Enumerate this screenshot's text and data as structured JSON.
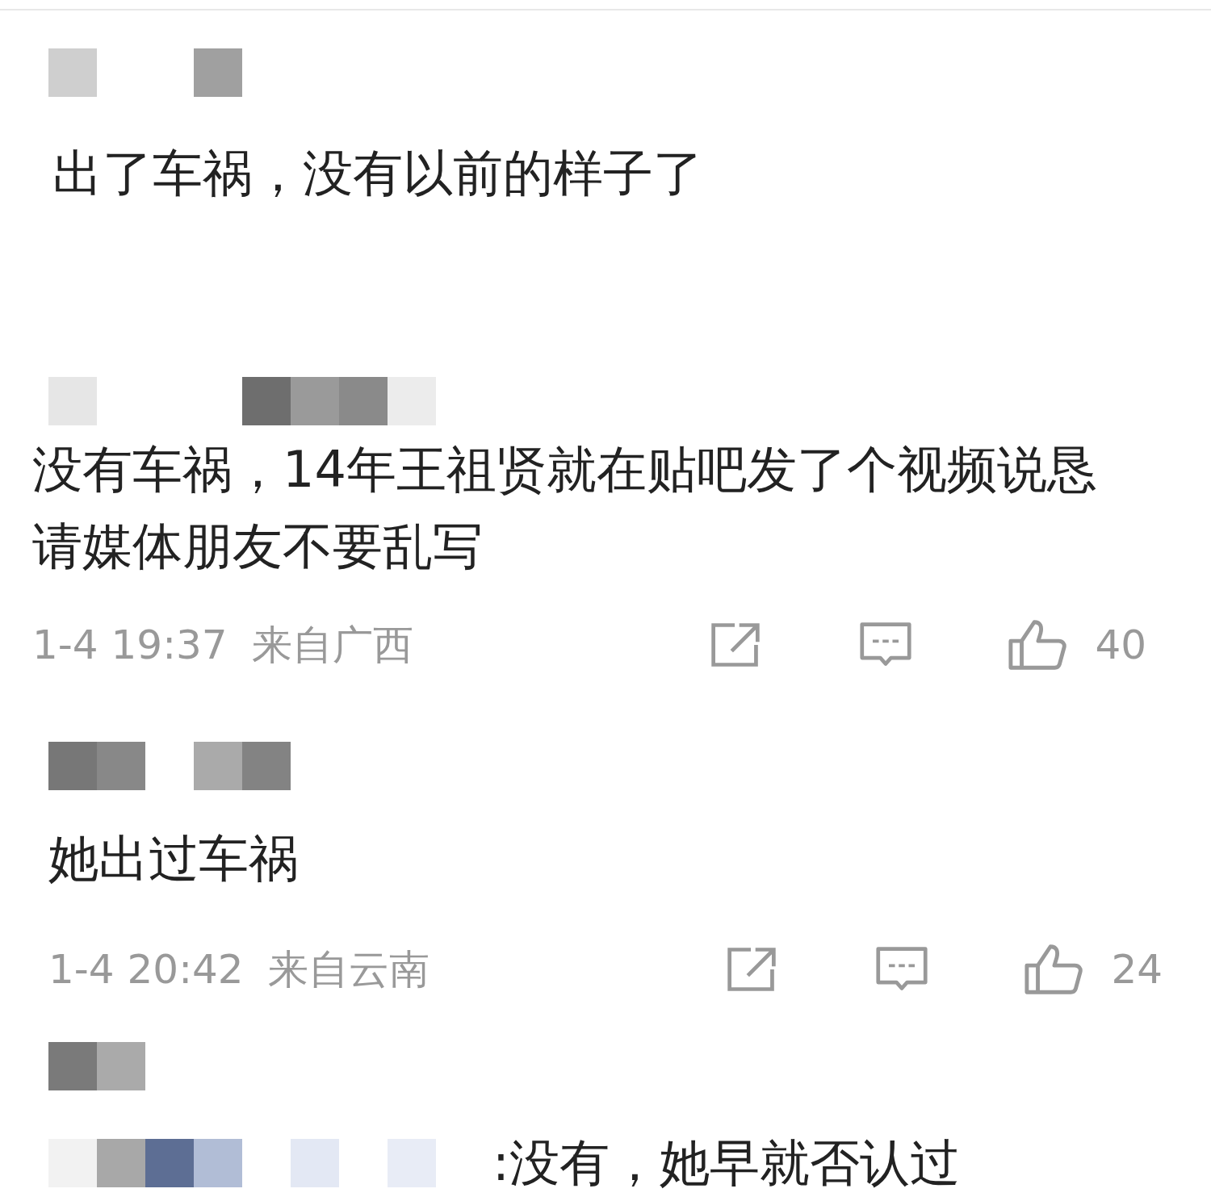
{
  "comments": [
    {
      "text": "出了车祸，没有以前的样子了"
    },
    {
      "text": "没有车祸，14年王祖贤就在贴吧发了个视频说恳请媒体朋友不要乱写",
      "time": "1-4 19:37",
      "location": "来自广西",
      "likes": "40"
    },
    {
      "text": "她出过车祸",
      "time": "1-4 20:42",
      "location": "来自云南",
      "likes": "24"
    },
    {
      "reply_text": ":没有，她早就否认过"
    }
  ]
}
